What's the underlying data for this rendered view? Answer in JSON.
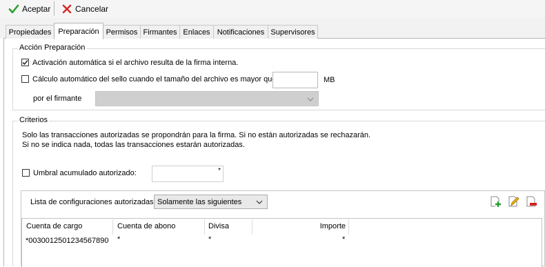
{
  "toolbar": {
    "accept_label": "Aceptar",
    "cancel_label": "Cancelar",
    "accept_icon": "green-check-icon",
    "cancel_icon": "red-x-icon"
  },
  "tabs": [
    {
      "label": "Propiedades",
      "active": false
    },
    {
      "label": "Preparación",
      "active": true
    },
    {
      "label": "Permisos",
      "active": false
    },
    {
      "label": "Firmantes",
      "active": false
    },
    {
      "label": "Enlaces",
      "active": false
    },
    {
      "label": "Notificaciones",
      "active": false
    },
    {
      "label": "Supervisores",
      "active": false
    }
  ],
  "preparation": {
    "title": "Acción Preparación",
    "auto_activation": {
      "label": "Activación automática si el archivo resulta de la firma interna.",
      "checked": true
    },
    "auto_seal": {
      "label": "Cálculo automático del sello cuando el tamaño del archivo es mayor que",
      "checked": false,
      "value": "",
      "unit": "MB"
    },
    "signer": {
      "label": "por el firmante",
      "value": "",
      "disabled": true
    }
  },
  "criteria": {
    "title": "Criterios",
    "info_line1": "Solo las transacciones autorizadas se propondrán para la firma. Si no están autorizadas se rechazarán.",
    "info_line2": "Si no se indica nada, todas las transacciones estarán autorizadas.",
    "threshold": {
      "label": "Umbral acumulado autorizado:",
      "checked": false,
      "value": "",
      "marker": "*"
    },
    "config_list": {
      "label": "Lista de configuraciones autorizadas:",
      "selected": "Solamente las siguientes",
      "icons": [
        "add-row-icon",
        "edit-row-icon",
        "delete-row-icon"
      ]
    },
    "table": {
      "columns": [
        "Cuenta de cargo",
        "Cuenta de abono",
        "Divisa",
        "Importe"
      ],
      "rows": [
        [
          "*0030012501234567890",
          "*",
          "*",
          "*"
        ]
      ]
    }
  }
}
